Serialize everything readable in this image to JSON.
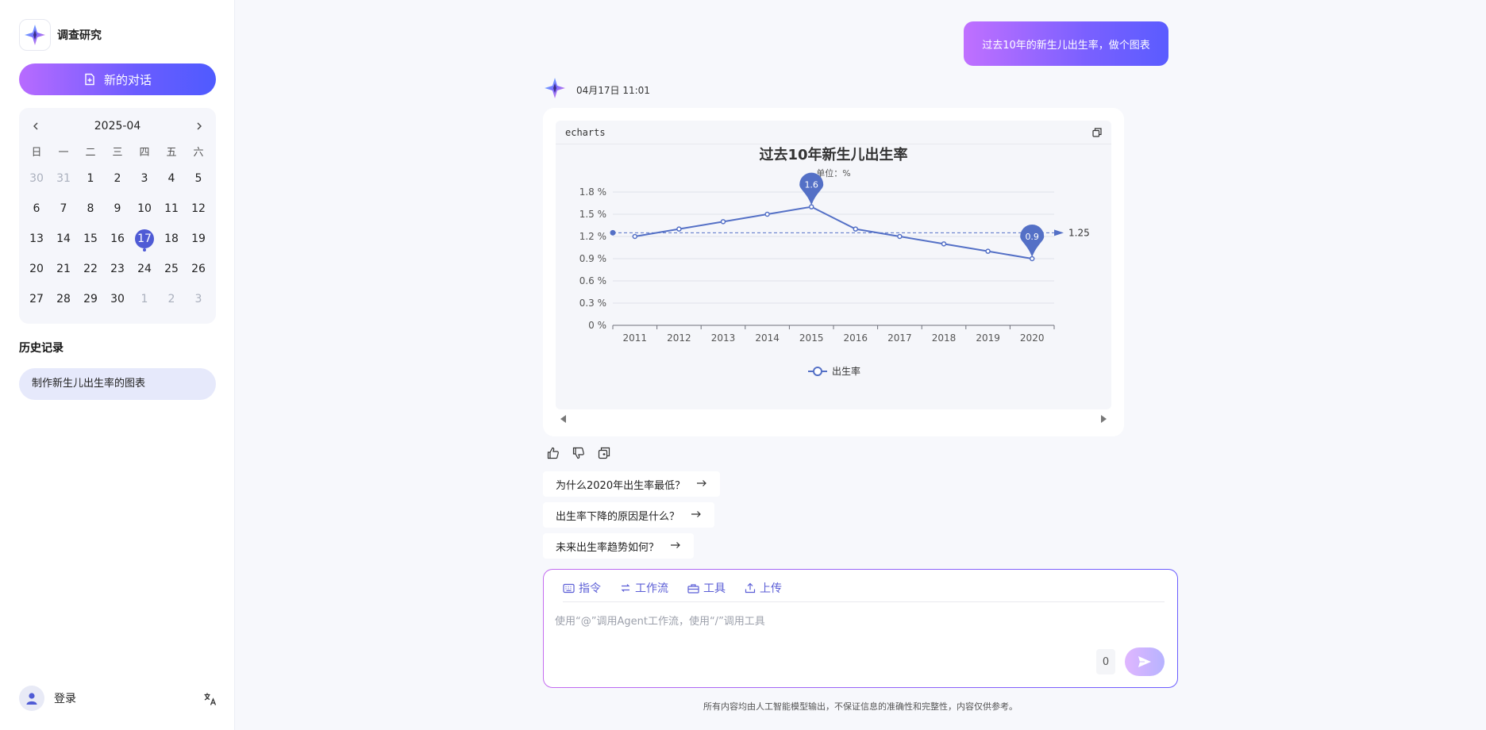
{
  "app": {
    "name": "调查研究"
  },
  "sidebar": {
    "new_chat_label": "新的对话",
    "calendar": {
      "month_label": "2025-04",
      "weekdays": [
        "日",
        "一",
        "二",
        "三",
        "四",
        "五",
        "六"
      ],
      "days": [
        {
          "n": "30",
          "other": true
        },
        {
          "n": "31",
          "other": true
        },
        {
          "n": "1"
        },
        {
          "n": "2"
        },
        {
          "n": "3"
        },
        {
          "n": "4"
        },
        {
          "n": "5"
        },
        {
          "n": "6"
        },
        {
          "n": "7"
        },
        {
          "n": "8"
        },
        {
          "n": "9"
        },
        {
          "n": "10"
        },
        {
          "n": "11"
        },
        {
          "n": "12"
        },
        {
          "n": "13"
        },
        {
          "n": "14"
        },
        {
          "n": "15"
        },
        {
          "n": "16"
        },
        {
          "n": "17",
          "today": true
        },
        {
          "n": "18"
        },
        {
          "n": "19"
        },
        {
          "n": "20"
        },
        {
          "n": "21"
        },
        {
          "n": "22"
        },
        {
          "n": "23"
        },
        {
          "n": "24"
        },
        {
          "n": "25"
        },
        {
          "n": "26"
        },
        {
          "n": "27"
        },
        {
          "n": "28"
        },
        {
          "n": "29"
        },
        {
          "n": "30"
        },
        {
          "n": "1",
          "other": true
        },
        {
          "n": "2",
          "other": true
        },
        {
          "n": "3",
          "other": true
        }
      ]
    },
    "history_title": "历史记录",
    "history_items": [
      "制作新生儿出生率的图表"
    ],
    "login_label": "登录",
    "lang_icon": "translate-icon"
  },
  "chat": {
    "user_message": "过去10年的新生儿出生率，做个图表",
    "bot_time": "04月17日 11:01",
    "code_lang": "echarts",
    "suggestions": [
      "为什么2020年出生率最低？",
      "出生率下降的原因是什么？",
      "未来出生率趋势如何？"
    ]
  },
  "chart_data": {
    "type": "line",
    "title": "过去10年新生儿出生率",
    "subtitle": "单位：%",
    "categories": [
      "2011",
      "2012",
      "2013",
      "2014",
      "2015",
      "2016",
      "2017",
      "2018",
      "2019",
      "2020"
    ],
    "series": [
      {
        "name": "出生率",
        "values": [
          1.2,
          1.3,
          1.4,
          1.5,
          1.6,
          1.3,
          1.2,
          1.1,
          1.0,
          0.9
        ]
      }
    ],
    "ylim": [
      0,
      1.8
    ],
    "yticks": [
      "0 %",
      "0.3 %",
      "0.6 %",
      "0.9 %",
      "1.2 %",
      "1.5 %",
      "1.8 %"
    ],
    "mark_points": [
      {
        "label": "1.6",
        "value": 1.6,
        "category": "2015"
      },
      {
        "label": "0.9",
        "value": 0.9,
        "category": "2020"
      }
    ],
    "mark_line": {
      "label": "1.25",
      "value": 1.25
    },
    "legend_position": "bottom",
    "color": "#5470c6"
  },
  "composer": {
    "tools": [
      "指令",
      "工作流",
      "工具",
      "上传"
    ],
    "placeholder": "使用“@”调用Agent工作流，使用“/”调用工具",
    "char_count": "0"
  },
  "disclaimer": "所有内容均由人工智能模型输出，不保证信息的准确性和完整性，内容仅供参考。",
  "colors": {
    "accent": "#4f5bd5",
    "gradient_start": "#b86bff",
    "gradient_end": "#4f5bff"
  }
}
